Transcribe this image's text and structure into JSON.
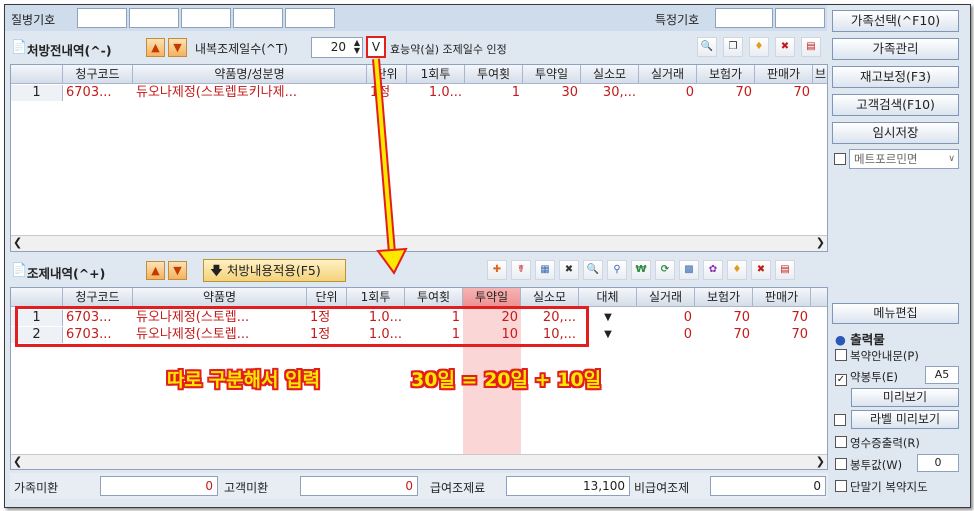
{
  "top": {
    "disease_code_label": "질병기호",
    "special_code_label": "특정기호"
  },
  "prescription": {
    "title": "처방전내역(^-)",
    "internal_days_label": "내복조제일수(^T)",
    "internal_days_value": "20",
    "check_mark": "V",
    "efficacy_label": "효능약(실) 조제일수 인정",
    "columns": [
      "청구코드",
      "약품명/성분명",
      "단위",
      "1회투",
      "투여횟",
      "투약일",
      "실소모",
      "실거래",
      "보험가",
      "판매가",
      "브"
    ],
    "rows": [
      {
        "no": "1",
        "code": "6703...",
        "name": "듀오나제정(스토렙토키나제...",
        "unit": "1정",
        "dose": "1.0...",
        "times": "1",
        "days": "30",
        "consume": "30,...",
        "actual": "0",
        "insurance": "70",
        "sale": "70"
      }
    ]
  },
  "dispense": {
    "title": "조제내역(^+)",
    "apply_button": "처방내용적용(F5)",
    "columns": [
      "청구코드",
      "약품명",
      "단위",
      "1회투",
      "투여횟",
      "투약일",
      "실소모",
      "대체",
      "실거래",
      "보험가",
      "판매가"
    ],
    "rows": [
      {
        "no": "1",
        "code": "6703...",
        "name": "듀오나제정(스토렙...",
        "unit": "1정",
        "dose": "1.0...",
        "times": "1",
        "days": "20",
        "consume": "20,...",
        "actual": "0",
        "insurance": "70",
        "sale": "70"
      },
      {
        "no": "2",
        "code": "6703...",
        "name": "듀오나제정(스토렙...",
        "unit": "1정",
        "dose": "1.0...",
        "times": "1",
        "days": "10",
        "consume": "10,...",
        "actual": "0",
        "insurance": "70",
        "sale": "70"
      }
    ]
  },
  "annotation": {
    "text1": "따로 구분해서 입력",
    "text2": "30일 = 20일 + 10일",
    "color": "#e11f1f"
  },
  "footer": {
    "family_unpaid_label": "가족미환",
    "family_unpaid_value": "0",
    "customer_unpaid_label": "고객미환",
    "customer_unpaid_value": "0",
    "paid_label": "급여조제료",
    "paid_value": "13,100",
    "nonpaid_label": "비급여조제",
    "nonpaid_value": "0"
  },
  "sidebar": {
    "buttons": [
      "가족선택(^F10)",
      "가족관리",
      "재고보정(F3)",
      "고객검색(F10)",
      "임시저장"
    ],
    "metformin_label": "메트포르민면",
    "menu_edit": "메뉴편집",
    "output_title": "출력물",
    "items": [
      {
        "label": "복약안내문(P)",
        "checked": false
      },
      {
        "label": "약봉투(E)",
        "checked": true,
        "extra": "A5"
      },
      {
        "label": "미리보기",
        "button": true
      },
      {
        "label": "라벨 미리보기",
        "checked": false,
        "button": true
      },
      {
        "label": "영수증출력(R)",
        "checked": false
      },
      {
        "label": "봉투값(W)",
        "checked": false,
        "extra": "0"
      },
      {
        "label": "단말기 복약지도",
        "checked": false
      }
    ]
  }
}
